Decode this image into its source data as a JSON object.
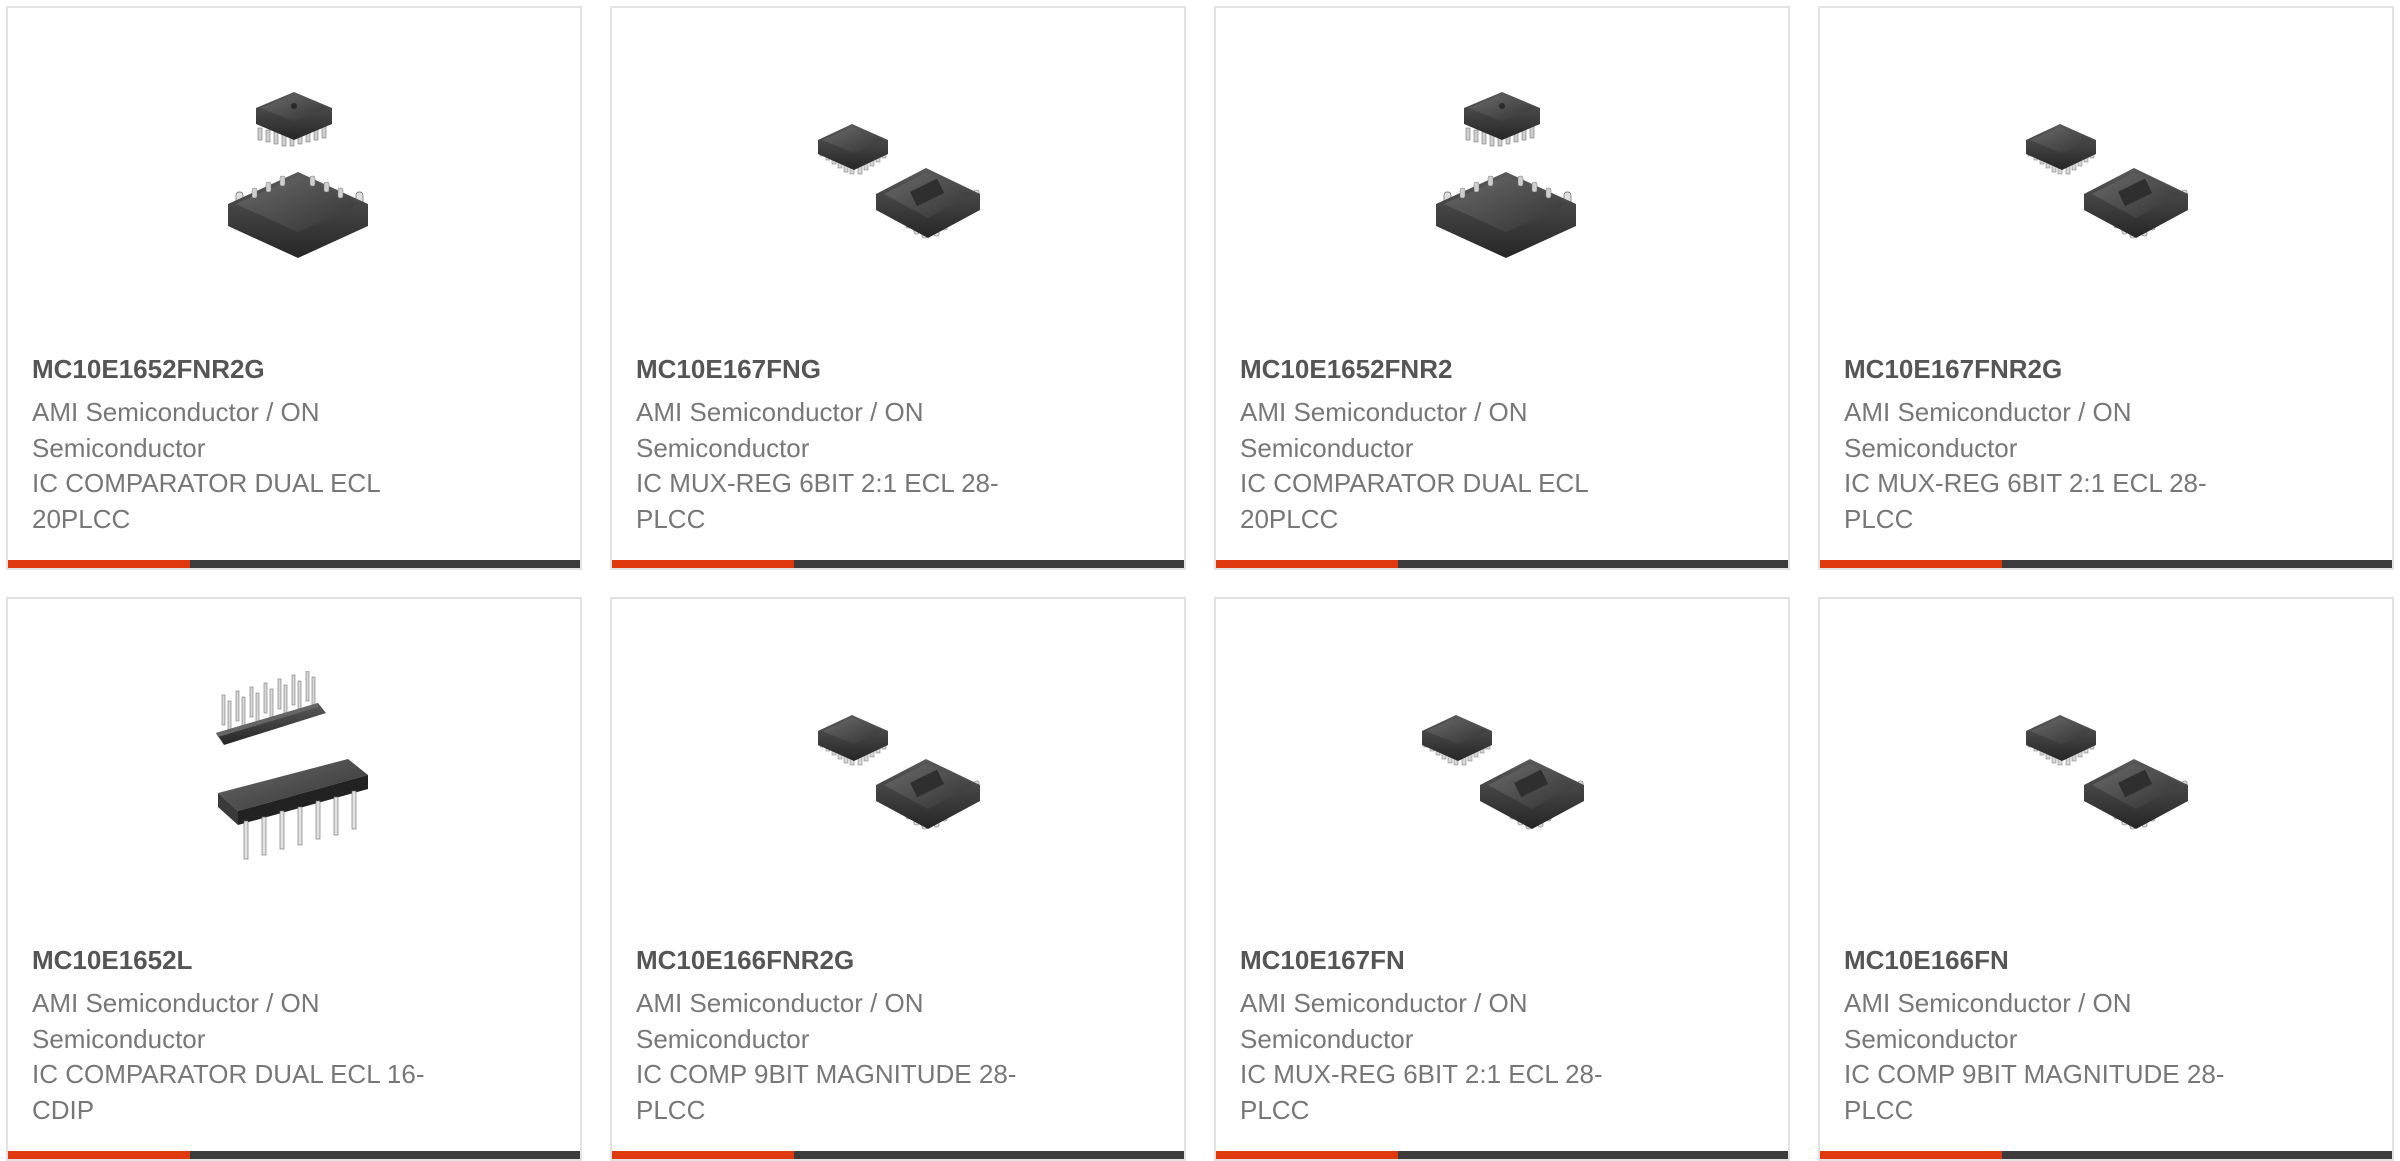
{
  "colors": {
    "accent": "#e0380f",
    "bar": "#3c3c3c",
    "title_text": "#555555",
    "body_text": "#777777",
    "border": "#e3e3e3"
  },
  "products": [
    {
      "part_number": "MC10E1652FNR2G",
      "manufacturer": "AMI Semiconductor / ON Semiconductor",
      "description": "IC COMPARATOR DUAL ECL 20PLCC",
      "image": "plcc-chip-stacked-icon"
    },
    {
      "part_number": "MC10E167FNG",
      "manufacturer": "AMI Semiconductor / ON Semiconductor",
      "description": "IC MUX-REG 6BIT 2:1 ECL 28-PLCC",
      "image": "plcc-chip-pair-icon"
    },
    {
      "part_number": "MC10E1652FNR2",
      "manufacturer": "AMI Semiconductor / ON Semiconductor",
      "description": "IC COMPARATOR DUAL ECL 20PLCC",
      "image": "plcc-chip-stacked-icon"
    },
    {
      "part_number": "MC10E167FNR2G",
      "manufacturer": "AMI Semiconductor / ON Semiconductor",
      "description": "IC MUX-REG 6BIT 2:1 ECL 28-PLCC",
      "image": "plcc-chip-pair-icon"
    },
    {
      "part_number": "MC10E1652L",
      "manufacturer": "AMI Semiconductor / ON Semiconductor",
      "description": "IC COMPARATOR DUAL ECL 16-CDIP",
      "image": "dip-chip-pair-icon"
    },
    {
      "part_number": "MC10E166FNR2G",
      "manufacturer": "AMI Semiconductor / ON Semiconductor",
      "description": "IC COMP 9BIT MAGNITUDE 28-PLCC",
      "image": "plcc-chip-pair-icon"
    },
    {
      "part_number": "MC10E167FN",
      "manufacturer": "AMI Semiconductor / ON Semiconductor",
      "description": "IC MUX-REG 6BIT 2:1 ECL 28-PLCC",
      "image": "plcc-chip-pair-icon"
    },
    {
      "part_number": "MC10E166FN",
      "manufacturer": "AMI Semiconductor / ON Semiconductor",
      "description": "IC COMP 9BIT MAGNITUDE 28-PLCC",
      "image": "plcc-chip-pair-icon"
    }
  ]
}
